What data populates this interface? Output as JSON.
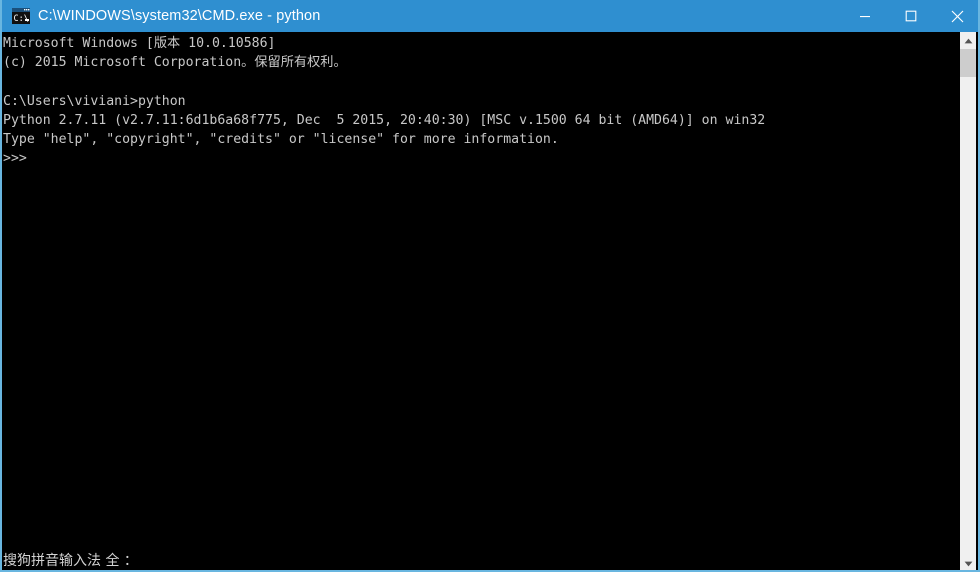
{
  "window": {
    "title": "C:\\WINDOWS\\system32\\CMD.exe - python",
    "icon": "cmd-exe-icon",
    "accent_color": "#2f8fd0",
    "border_color": "#69b6e0",
    "console_background": "#000000",
    "console_foreground": "#c8c8c8"
  },
  "titlebar_buttons": {
    "minimize_label": "Minimize",
    "maximize_label": "Maximize",
    "close_label": "Close"
  },
  "console": {
    "lines": [
      "Microsoft Windows [版本 10.0.10586]",
      "(c) 2015 Microsoft Corporation。保留所有权利。",
      "",
      "C:\\Users\\viviani>python",
      "Python 2.7.11 (v2.7.11:6d1b6a68f775, Dec  5 2015, 20:40:30) [MSC v.1500 64 bit (AMD64)] on win32",
      "Type \"help\", \"copyright\", \"credits\" or \"license\" for more information.",
      ">>>"
    ],
    "text": "Microsoft Windows [版本 10.0.10586]\n(c) 2015 Microsoft Corporation。保留所有权利。\n\nC:\\Users\\viviani>python\nPython 2.7.11 (v2.7.11:6d1b6a68f775, Dec  5 2015, 20:40:30) [MSC v.1500 64 bit (AMD64)] on win32\nType \"help\", \"copyright\", \"credits\" or \"license\" for more information.\n>>>"
  },
  "ime": {
    "status_text": "搜狗拼音输入法 全 ："
  },
  "scrollbar": {
    "up_arrow": "scroll-up-arrow-icon",
    "down_arrow": "scroll-down-arrow-icon",
    "track_color": "#f0f0f0",
    "thumb_color": "#cdcdcd"
  }
}
